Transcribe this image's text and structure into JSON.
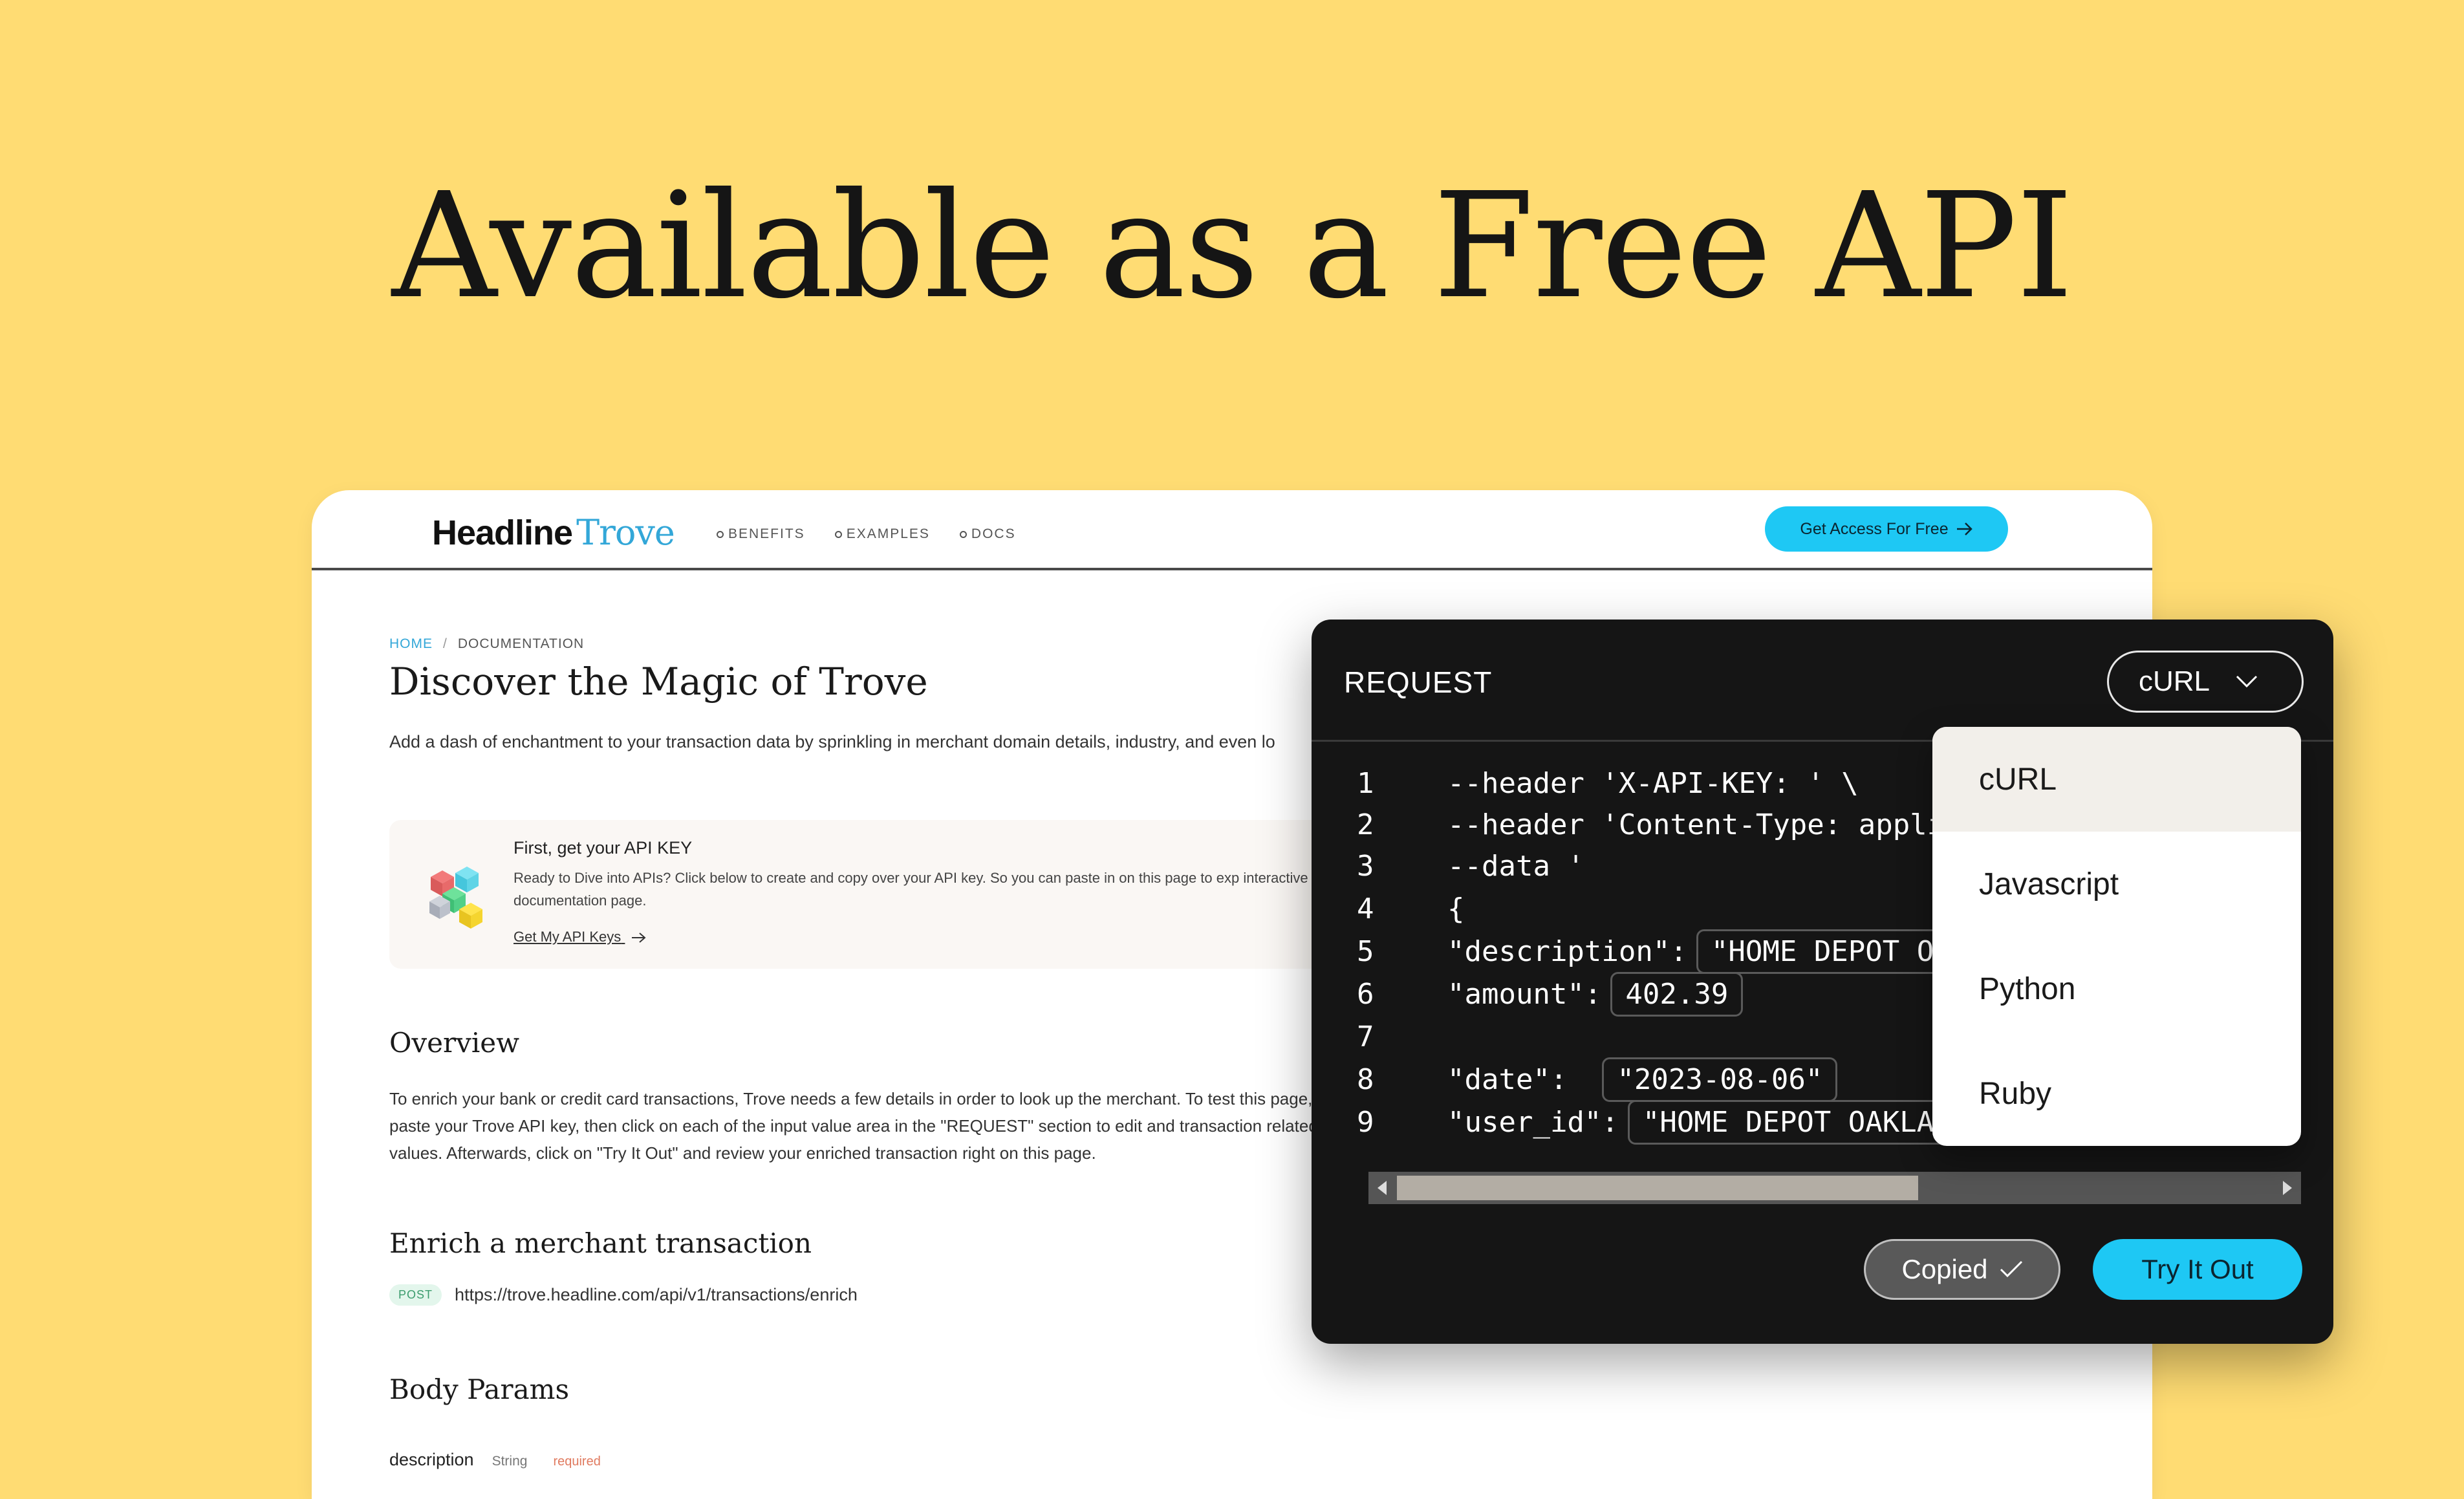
{
  "hero": {
    "title": "Available as a Free API"
  },
  "site": {
    "logo_part1": "Headline",
    "logo_part2": "Trove",
    "nav": [
      "BENEFITS",
      "EXAMPLES",
      "DOCS"
    ],
    "cta_label": "Get Access For Free"
  },
  "breadcrumb": {
    "home": "HOME",
    "separator": "/",
    "current": "DOCUMENTATION"
  },
  "doc": {
    "title": "Discover the Magic of Trove",
    "lead": "Add a dash of enchantment to your transaction data by sprinkling in merchant domain details, industry, and even lo",
    "apikey_card": {
      "title": "First, get your API KEY",
      "text": "Ready to Dive into APIs? Click below to create and copy over your API key. So you can paste in on this page to exp interactive documentation page.",
      "link": "Get My API Keys"
    },
    "overview_heading": "Overview",
    "overview_text": "To enrich your bank or credit card transactions, Trove needs a few details in order to look up the merchant. To test this page, paste your Trove API key, then click on each of the input value area in the \"REQUEST\" section to edit and transaction related values. Afterwards, click on \"Try It Out\" and review your enriched transaction right on this page.",
    "enrich_heading": "Enrich a merchant transaction",
    "endpoint_method": "POST",
    "endpoint_url": "https://trove.headline.com/api/v1/transactions/enrich",
    "body_params_heading": "Body Params",
    "param": {
      "name": "description",
      "type": "String",
      "required": "required"
    }
  },
  "request": {
    "title": "REQUEST",
    "selected_language": "cURL",
    "code": [
      {
        "n": "1",
        "text": "--header 'X-API-KEY: ' \\"
      },
      {
        "n": "2",
        "text": "--header 'Content-Type: applica"
      },
      {
        "n": "3",
        "text": "--data '"
      },
      {
        "n": "4",
        "text": "{"
      },
      {
        "n": "5",
        "key": "\"description\":",
        "value": "\"HOME DEPOT OAK"
      },
      {
        "n": "6",
        "key": "\"amount\":",
        "value": "402.39"
      },
      {
        "n": "7",
        "text": ""
      },
      {
        "n": "8",
        "key": "\"date\":",
        "value": "\"2023-08-06\""
      },
      {
        "n": "9",
        "key": "\"user_id\":",
        "value": "\"HOME DEPOT OAKLAND"
      }
    ],
    "copied_label": "Copied",
    "try_label": "Try It Out",
    "languages": [
      "cURL",
      "Javascript",
      "Python",
      "Ruby"
    ]
  }
}
